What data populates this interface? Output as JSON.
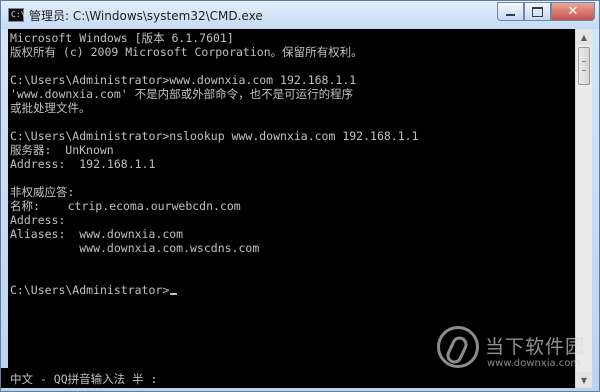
{
  "window": {
    "title": "管理员: C:\\Windows\\system32\\CMD.exe",
    "icon_text": "C:\\",
    "buttons": {
      "minimize": "minimize-icon",
      "maximize": "maximize-icon",
      "close": "✕"
    }
  },
  "console": {
    "lines": [
      "Microsoft Windows [版本 6.1.7601]",
      "版权所有 (c) 2009 Microsoft Corporation。保留所有权利。",
      "",
      "C:\\Users\\Administrator>www.downxia.com 192.168.1.1",
      "'www.downxia.com' 不是内部或外部命令，也不是可运行的程序",
      "或批处理文件。",
      "",
      "C:\\Users\\Administrator>nslookup www.downxia.com 192.168.1.1",
      "服务器:  UnKnown",
      "Address:  192.168.1.1",
      "",
      "非权威应答:",
      "名称:    ctrip.ecoma.ourwebcdn.com",
      "Address:",
      "Aliases:  www.downxia.com",
      "          www.downxia.com.wscdns.com",
      "",
      "",
      "C:\\Users\\Administrator>"
    ]
  },
  "ime": {
    "status": "中文 - QQ拼音输入法 半 :"
  },
  "watermark": {
    "name": "当下软件园",
    "url": "www.downxia.com"
  },
  "colors": {
    "console_bg": "#000000",
    "console_fg": "#c0c0c0",
    "close_button": "#c75050"
  }
}
